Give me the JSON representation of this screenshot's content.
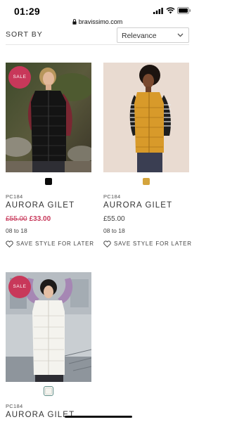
{
  "status_bar": {
    "time": "01:29"
  },
  "browser": {
    "url": "bravissimo.com"
  },
  "sort": {
    "label": "SORT BY",
    "value": "Relevance"
  },
  "products": [
    {
      "badge": "SALE",
      "swatch_color": "#0b0b0b",
      "code": "PC184",
      "name": "AURORA GILET",
      "price_was": "£55.00",
      "price_now": "£33.00",
      "sizes": "08 to 18",
      "save_label": "SAVE STYLE FOR LATER"
    },
    {
      "swatch_color": "#d4a43c",
      "code": "PC184",
      "name": "AURORA GILET",
      "price": "£55.00",
      "sizes": "08 to 18",
      "save_label": "SAVE STYLE FOR LATER"
    },
    {
      "badge": "SALE",
      "swatch_color": "#f4f4ef",
      "code": "PC184",
      "name": "AURORA GILET"
    }
  ],
  "colors": {
    "sale": "#c8385a",
    "swatch_outline": "#5d8a83"
  }
}
